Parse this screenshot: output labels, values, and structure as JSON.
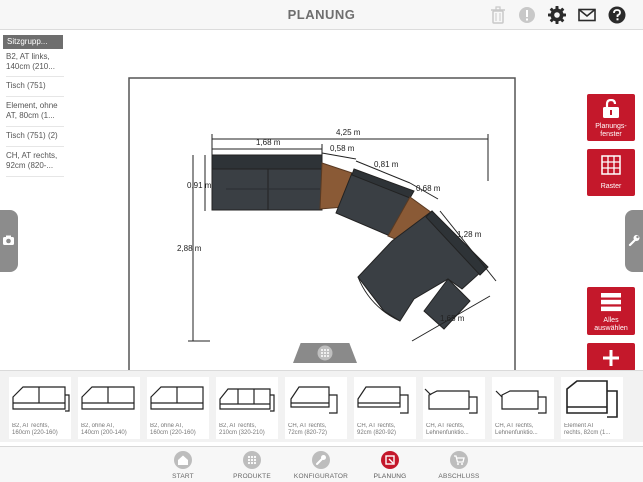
{
  "header": {
    "title": "PLANUNG",
    "icons": [
      "trash-icon",
      "info-icon",
      "gear-icon",
      "mail-icon",
      "help-icon"
    ]
  },
  "sidebar": {
    "group_label": "Sitzgrupp...",
    "items": [
      {
        "label_line1": "B2, AT links,",
        "label_line2": "140cm (210..."
      },
      {
        "label_line1": "Tisch (751)",
        "label_line2": ""
      },
      {
        "label_line1": "Element, ohne",
        "label_line2": "AT, 80cm (1..."
      },
      {
        "label_line1": "Tisch (751) (2)",
        "label_line2": ""
      },
      {
        "label_line1": "CH, AT rechts,",
        "label_line2": "92cm (820-..."
      }
    ]
  },
  "plan": {
    "dimensions": [
      "4,25 m",
      "1,68 m",
      "0,58 m",
      "0,81 m",
      "0,68 m",
      "0,91 m",
      "2,88 m",
      "1,28 m",
      "1,65 m"
    ]
  },
  "right_panel": {
    "planning_window_label_1": "Planungs-",
    "planning_window_label_2": "fenster",
    "grid_label": "Raster",
    "select_all_label_1": "Alles",
    "select_all_label_2": "auswählen"
  },
  "products": [
    {
      "line1": "B2, AT rechts,",
      "line2": "160cm (220-160)"
    },
    {
      "line1": "B2, ohne AT,",
      "line2": "140cm (200-140)"
    },
    {
      "line1": "B2, ohne AT,",
      "line2": "160cm (220-160)"
    },
    {
      "line1": "B2, AT rechts,",
      "line2": "210cm (320-210)"
    },
    {
      "line1": "CH, AT rechts,",
      "line2": "72cm (820-72)"
    },
    {
      "line1": "CH, AT rechts,",
      "line2": "92cm (820-92)"
    },
    {
      "line1": "CH, AT rechts,",
      "line2": "Lehnenfunktio..."
    },
    {
      "line1": "CH, AT rechts,",
      "line2": "Lehnenfunktio..."
    },
    {
      "line1": "Element AT",
      "line2": "rechts, 82cm (1..."
    }
  ],
  "tabs": [
    {
      "label": "START",
      "icon": "home-icon",
      "active": false
    },
    {
      "label": "PRODUKTE",
      "icon": "products-icon",
      "active": false
    },
    {
      "label": "KONFIGURATOR",
      "icon": "wrench-icon",
      "active": false
    },
    {
      "label": "PLANUNG",
      "icon": "planning-icon",
      "active": true
    },
    {
      "label": "ABSCHLUSS",
      "icon": "cart-icon",
      "active": false
    }
  ],
  "colors": {
    "accent": "#c4182b",
    "sofa": "#3a3f44",
    "table_wood": "#8a5a36",
    "header_text": "#6e6e6e"
  }
}
